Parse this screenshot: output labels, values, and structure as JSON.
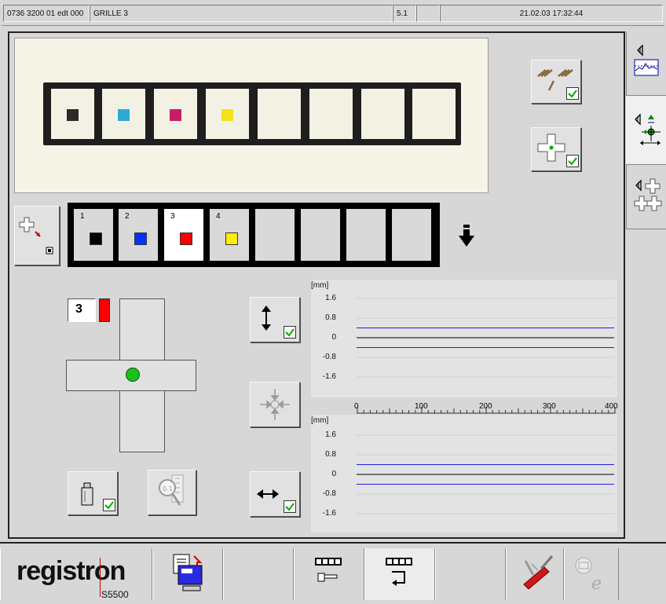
{
  "status_bar": {
    "job_id": "0736 3200 01 edt 000",
    "job_name": "GRILLE   3",
    "version": "5.1",
    "datetime": "21.02.03 17:32:44"
  },
  "photo": {
    "patches": [
      "#2a2a2a",
      "#2fa8d8",
      "#c41e6a",
      "#f2e21c",
      "",
      "",
      "",
      ""
    ]
  },
  "unit_strip": {
    "units": [
      {
        "number": "1",
        "color": "#000000"
      },
      {
        "number": "2",
        "color": "#0033ff"
      },
      {
        "number": "3",
        "color": "#ff0000"
      },
      {
        "number": "4",
        "color": "#ffee00"
      },
      {
        "number": "",
        "color": ""
      },
      {
        "number": "",
        "color": ""
      },
      {
        "number": "",
        "color": ""
      },
      {
        "number": "",
        "color": ""
      }
    ],
    "selected_index": 2
  },
  "cross_panel": {
    "unit_number": "3",
    "unit_color": "#ff0000",
    "indicator_color": "#18c018"
  },
  "graph_top": {
    "unit": "[mm]",
    "y_ticks": [
      "1.6",
      "0.8",
      "0",
      "-0.8",
      "-1.6"
    ]
  },
  "graph_bottom": {
    "unit": "[mm]",
    "y_ticks": [
      "1.6",
      "0.8",
      "0",
      "-0.8",
      "-1.6"
    ]
  },
  "ruler": {
    "labels": [
      "0",
      "100",
      "200",
      "300",
      "400"
    ]
  },
  "taskbar": {
    "brand": "registron",
    "model": "S5500"
  },
  "chart_data": [
    {
      "type": "line",
      "ylabel": "[mm]",
      "ylim": [
        -1.6,
        1.6
      ],
      "xlim": [
        0,
        400
      ],
      "series": [
        {
          "values": [
            0.4,
            0.4
          ],
          "x": [
            0,
            400
          ],
          "color": "#2020e0"
        },
        {
          "values": [
            0,
            0
          ],
          "x": [
            0,
            400
          ],
          "color": "#000000"
        },
        {
          "values": [
            -0.4,
            -0.4
          ],
          "x": [
            0,
            400
          ],
          "color": "#2020e0"
        }
      ]
    },
    {
      "type": "line",
      "ylabel": "[mm]",
      "ylim": [
        -1.6,
        1.6
      ],
      "xlim": [
        0,
        400
      ],
      "series": [
        {
          "values": [
            0.4,
            0.4
          ],
          "x": [
            0,
            400
          ],
          "color": "#2020e0"
        },
        {
          "values": [
            0,
            0
          ],
          "x": [
            0,
            400
          ],
          "color": "#000000"
        },
        {
          "values": [
            -0.4,
            -0.4
          ],
          "x": [
            0,
            400
          ],
          "color": "#2020e0"
        }
      ]
    }
  ],
  "icons": {
    "tab_1": "tolerance-graph-icon",
    "tab_2": "register-adjust-icon",
    "tab_3": "crosshair-grid-icon",
    "photo_tool_1": "register-marks-icon",
    "photo_tool_2": "crosshair-center-icon",
    "strip_tool": "crosshair-select-icon",
    "scroll_down": "arrow-down-icon",
    "vertical": "vertical-arrow-icon",
    "center": "auto-center-icon",
    "horizontal": "horizontal-arrow-icon",
    "weight": "weight-icon",
    "zoom": "magnifier-icon"
  }
}
